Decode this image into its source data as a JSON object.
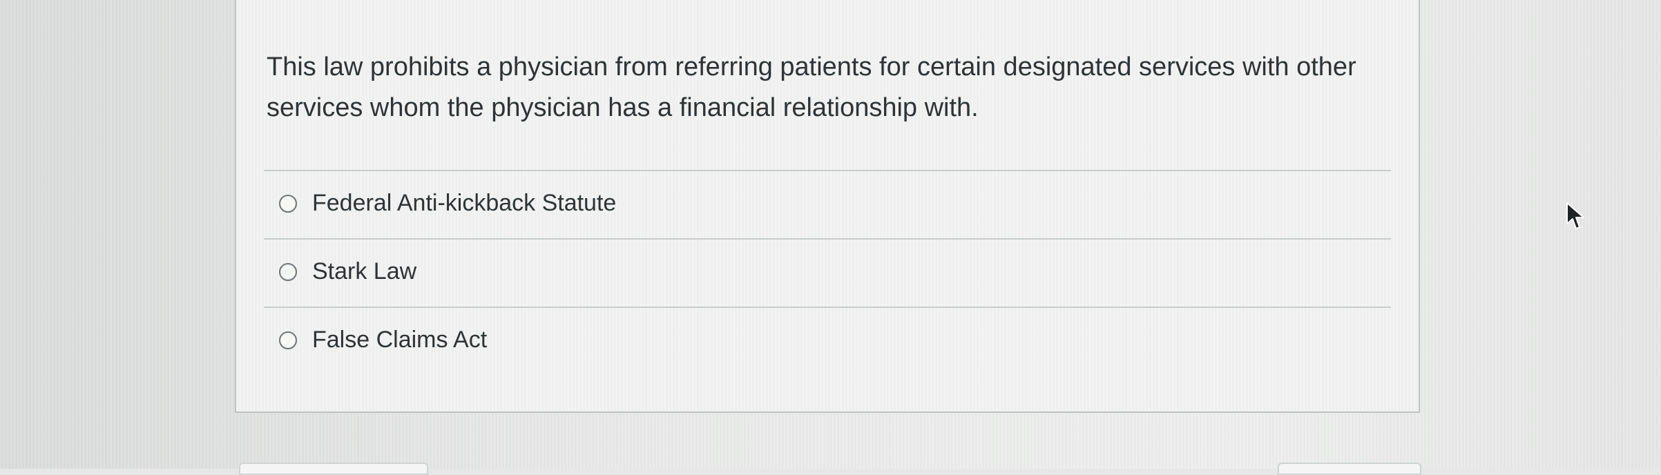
{
  "question": {
    "text": "This law prohibits a physician from referring patients for certain designated services with other services whom the physician has a financial relationship with.",
    "options": [
      {
        "label": "Federal Anti-kickback Statute",
        "selected": false
      },
      {
        "label": "Stark Law",
        "selected": false
      },
      {
        "label": "False Claims Act",
        "selected": false
      }
    ]
  },
  "icons": {
    "pointer": "mouse-pointer-icon",
    "radio": "radio-unselected"
  },
  "colors": {
    "background": "#e6e7e6",
    "card": "#f0f1f0",
    "text": "#2f3335",
    "border": "#bfc2c2"
  }
}
